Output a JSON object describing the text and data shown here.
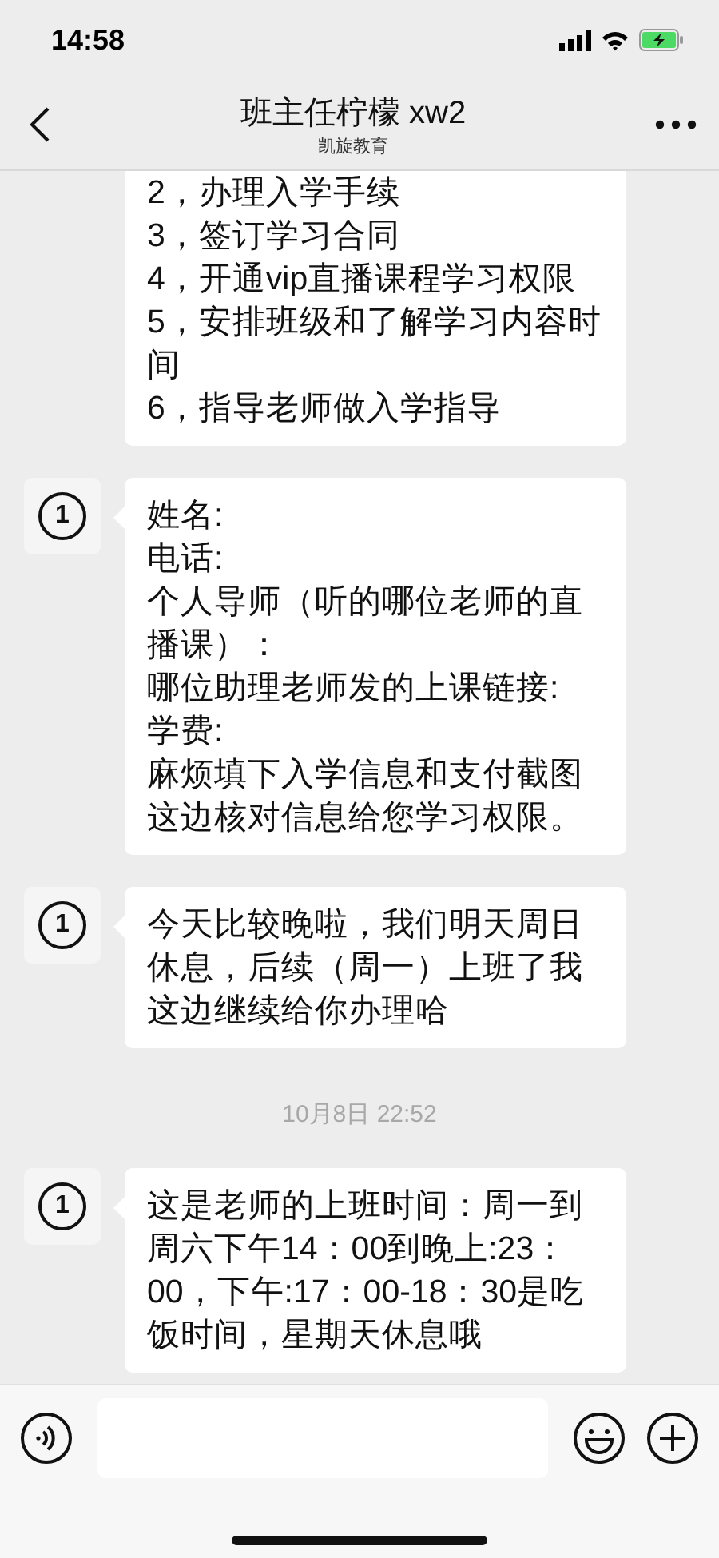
{
  "status_bar": {
    "time": "14:58",
    "charging": true
  },
  "header": {
    "title": "班主任柠檬 xw2",
    "subtitle": "凯旋教育"
  },
  "messages": [
    {
      "kind": "message",
      "paragraphs": [
        "2，办理入学手续",
        "3，签订学习合同",
        "4，开通vip直播课程学习权限",
        "5，安排班级和了解学习内容时间",
        "6，指导老师做入学指导"
      ]
    },
    {
      "kind": "message",
      "avatar": "1",
      "paragraphs": [
        "姓名:",
        "电话:",
        "个人导师（听的哪位老师的直播课）：",
        "哪位助理老师发的上课链接:",
        "学费:",
        "麻烦填下入学信息和支付截图这边核对信息给您学习权限。"
      ]
    },
    {
      "kind": "message",
      "avatar": "1",
      "paragraphs": [
        "今天比较晚啦，我们明天周日休息，后续（周一）上班了我这边继续给你办理哈"
      ]
    },
    {
      "kind": "timestamp",
      "text": "10月8日 22:52"
    },
    {
      "kind": "message",
      "avatar": "1",
      "paragraphs": [
        "这是老师的上班时间：周一到",
        "周六下午14：00到晚上:23：",
        "00，下午:17：00-18：30是吃",
        "饭时间，星期天休息哦"
      ]
    }
  ]
}
